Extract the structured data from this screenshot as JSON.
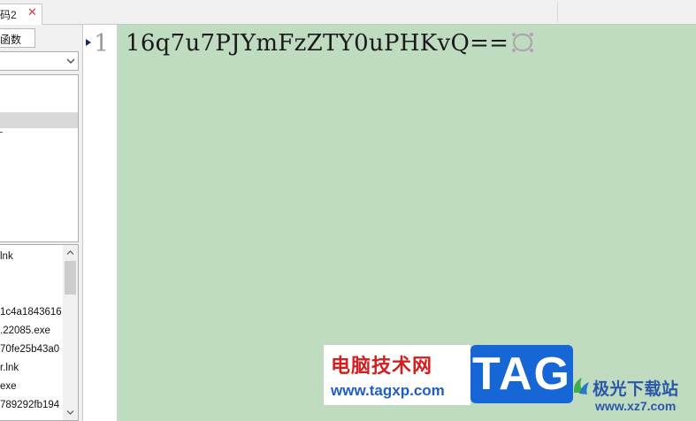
{
  "tabs": [
    {
      "label": "码2",
      "close_glyph": "✕"
    }
  ],
  "sidebar": {
    "function_tab_label": "函数",
    "combo_value": "",
    "files": [
      "lnk",
      "",
      "",
      "1c4a1843616",
      ".22085.exe",
      "70fe25b43a0",
      "r.lnk",
      "exe",
      "789292fb194"
    ]
  },
  "editor": {
    "line_number": "1",
    "line_text": "16q7u7PJYmFzZTY0uPHKvQ=="
  },
  "watermarks": {
    "brand_cn": "电脑技术网",
    "brand_url": "www.tagxp.com",
    "tag_text": "TAG",
    "second_brand_cn": "极光下载站",
    "second_brand_url": "www.xz7.com"
  },
  "colors": {
    "editor_bg": "#c0dcc0",
    "gutter_bg": "#ffffff",
    "brand_red": "#d51f1f",
    "brand_blue": "#1766d6"
  },
  "icons": {
    "tab_close": "close-icon",
    "combo_dropdown": "chevron-down-icon",
    "scroll_up": "arrow-up-icon",
    "scroll_down": "arrow-down-icon",
    "fold_marker": "fold-triangle-icon",
    "eol": "eol-symbol-icon"
  }
}
